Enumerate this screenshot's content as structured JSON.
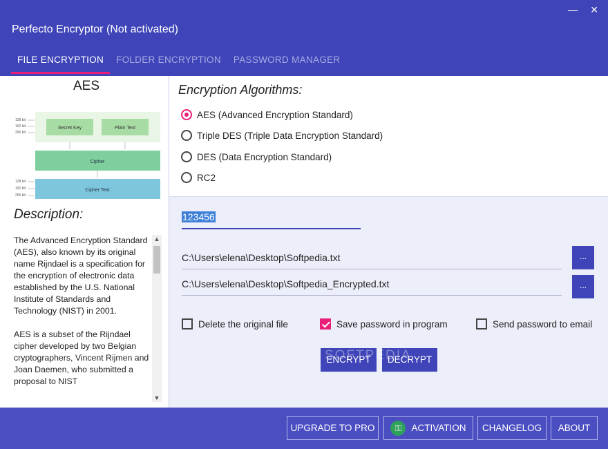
{
  "window": {
    "title": "Perfecto Encryptor (Not activated)",
    "minimize_glyph": "—",
    "close_glyph": "✕"
  },
  "tabs": [
    {
      "label": "FILE ENCRYPTION",
      "active": true
    },
    {
      "label": "FOLDER ENCRYPTION",
      "active": false
    },
    {
      "label": "PASSWORD MANAGER",
      "active": false
    }
  ],
  "left": {
    "algorithm_name": "AES",
    "diagram": {
      "bits": [
        "128 bit",
        "192 bit",
        "256 bit"
      ],
      "secret_key": "Secret Key",
      "plain_text": "Plain Text",
      "cipher": "Cipher",
      "cipher_text": "Cipher Text"
    },
    "description_title": "Description:",
    "description_p1": "The Advanced Encryption Standard (AES), also known by its original name Rijndael is a specification for the encryption of electronic data established by the U.S. National Institute of Standards and Technology (NIST) in 2001.",
    "description_p2": "AES is a subset of the Rijndael cipher developed by two Belgian cryptographers, Vincent Rijmen and Joan Daemen, who submitted a proposal to NIST"
  },
  "algorithms": {
    "heading": "Encryption Algorithms:",
    "options": [
      {
        "label": "AES (Advanced Encryption Standard)",
        "selected": true
      },
      {
        "label": "Triple DES (Triple Data Encryption Standard)",
        "selected": false
      },
      {
        "label": "DES (Data Encryption Standard)",
        "selected": false
      },
      {
        "label": "RC2",
        "selected": false
      }
    ]
  },
  "form": {
    "password": "123456",
    "source_path": "C:\\Users\\elena\\Desktop\\Softpedia.txt",
    "target_path": "C:\\Users\\elena\\Desktop\\Softpedia_Encrypted.txt",
    "browse_label": "...",
    "options": [
      {
        "label": "Delete the original file",
        "checked": false
      },
      {
        "label": "Save password in program",
        "checked": true
      },
      {
        "label": "Send password to email",
        "checked": false
      }
    ],
    "encrypt_label": "ENCRYPT",
    "decrypt_label": "DECRYPT",
    "watermark": "SOFTPEDIA"
  },
  "footer": {
    "upgrade_label": "UPGRADE TO PRO",
    "activation_label": "ACTIVATION",
    "changelog_label": "CHANGELOG",
    "about_label": "ABOUT"
  },
  "colors": {
    "header": "#3f44b8",
    "accent": "#e91e78",
    "panel_bg": "#eceef9",
    "key_icon": "#2da05a"
  },
  "icons": {
    "activation": "key-icon",
    "scroll_up": "chevron-up-icon",
    "scroll_down": "chevron-down-icon"
  }
}
